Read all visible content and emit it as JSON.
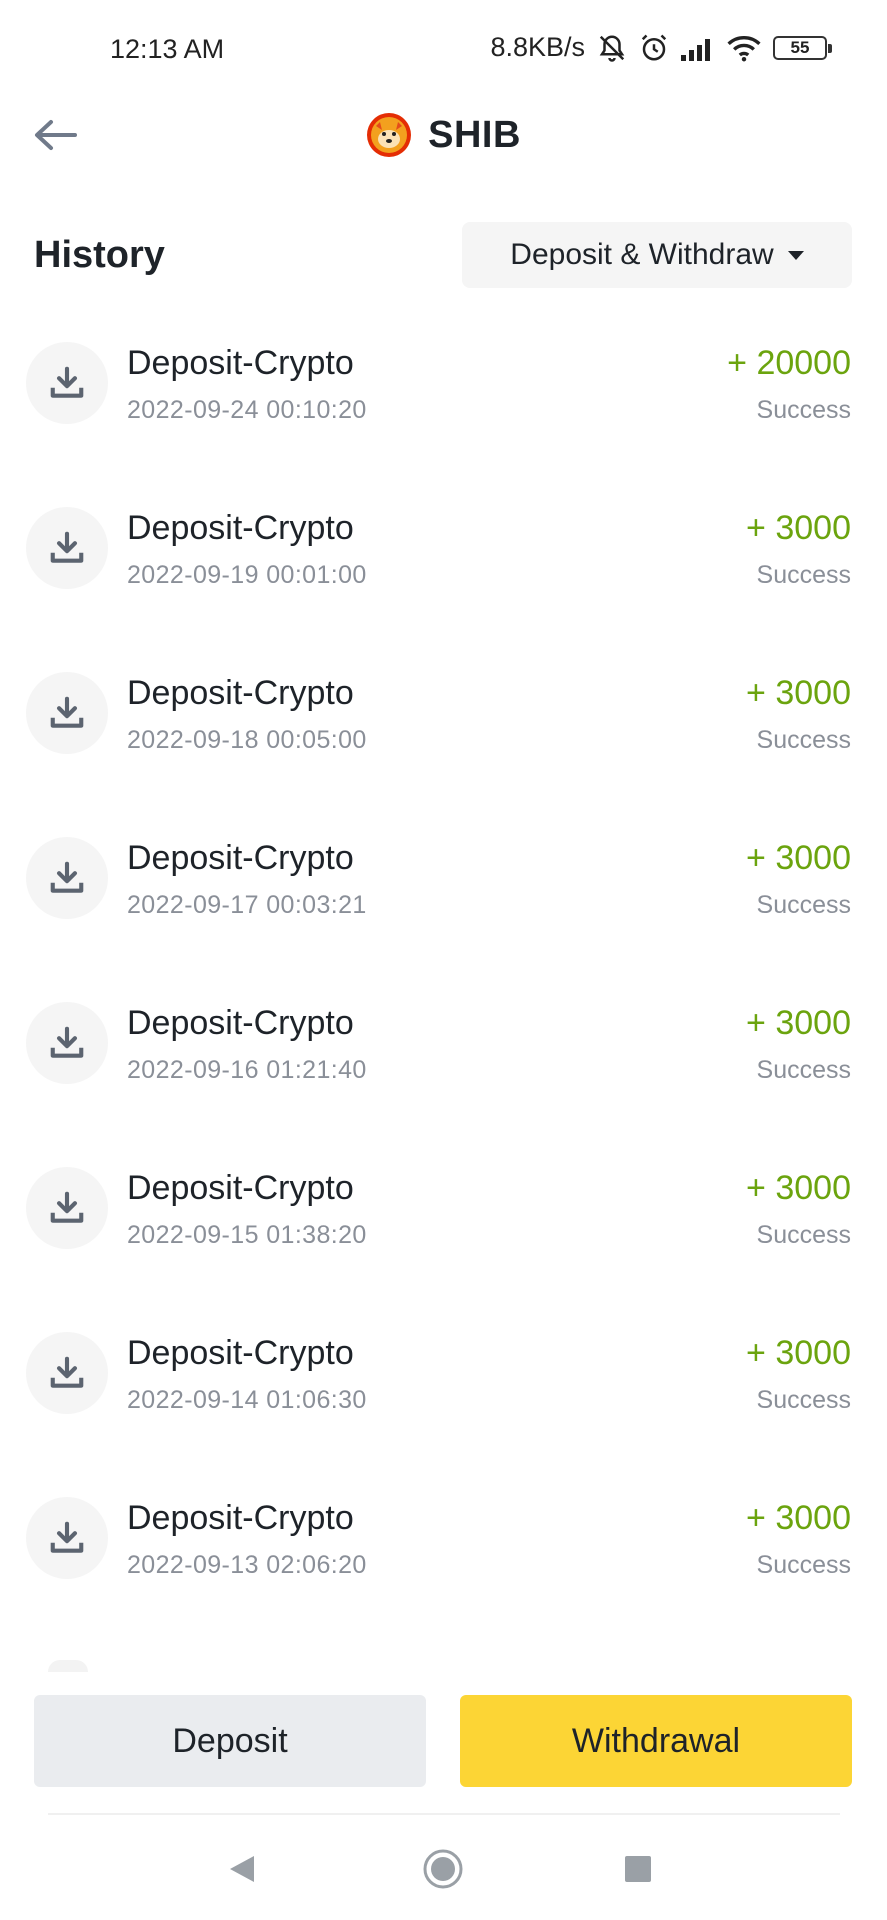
{
  "status_bar": {
    "time": "12:13 AM",
    "net_speed": "8.8KB/s",
    "battery_level": "55",
    "icons": [
      "mute-bell-icon",
      "alarm-icon",
      "signal-icon",
      "wifi-icon",
      "battery-icon"
    ]
  },
  "header": {
    "title": "SHIB",
    "back_icon": "arrow-left-icon",
    "logo": "shib-coin-logo"
  },
  "history": {
    "title": "History",
    "filter_label": "Deposit & Withdraw"
  },
  "transactions": [
    {
      "title": "Deposit-Crypto",
      "date": "2022-09-24 00:10:20",
      "amount": "+ 20000",
      "status": "Success"
    },
    {
      "title": "Deposit-Crypto",
      "date": "2022-09-19 00:01:00",
      "amount": "+ 3000",
      "status": "Success"
    },
    {
      "title": "Deposit-Crypto",
      "date": "2022-09-18 00:05:00",
      "amount": "+ 3000",
      "status": "Success"
    },
    {
      "title": "Deposit-Crypto",
      "date": "2022-09-17 00:03:21",
      "amount": "+ 3000",
      "status": "Success"
    },
    {
      "title": "Deposit-Crypto",
      "date": "2022-09-16 01:21:40",
      "amount": "+ 3000",
      "status": "Success"
    },
    {
      "title": "Deposit-Crypto",
      "date": "2022-09-15 01:38:20",
      "amount": "+ 3000",
      "status": "Success"
    },
    {
      "title": "Deposit-Crypto",
      "date": "2022-09-14 01:06:30",
      "amount": "+ 3000",
      "status": "Success"
    },
    {
      "title": "Deposit-Crypto",
      "date": "2022-09-13 02:06:20",
      "amount": "+ 3000",
      "status": "Success"
    }
  ],
  "actions": {
    "deposit_label": "Deposit",
    "withdraw_label": "Withdrawal"
  },
  "colors": {
    "accent_yellow": "#fcd535",
    "positive_green": "#6ba40e",
    "muted_text": "#8a8f98"
  }
}
